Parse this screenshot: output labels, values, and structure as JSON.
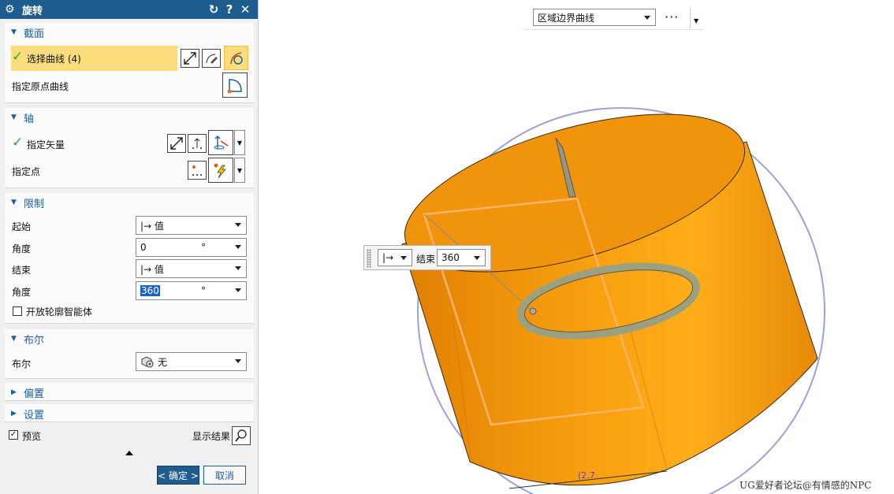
{
  "dialog": {
    "title": "旋转",
    "header_buttons": [
      "reset-icon",
      "help-icon",
      "close-icon"
    ],
    "sections": {
      "section": {
        "title": "截面",
        "select_curve": "选择曲线 (4)",
        "origin_curve": "指定原点曲线"
      },
      "axis": {
        "title": "轴",
        "vector": "指定矢量",
        "point": "指定点"
      },
      "limits": {
        "title": "限制",
        "start_label": "起始",
        "start_value": "|→ 值",
        "start_angle_label": "角度",
        "start_angle": "0",
        "start_unit": "°",
        "end_label": "结束",
        "end_value": "|→ 值",
        "end_angle_label": "角度",
        "end_angle": "360",
        "end_unit": "°",
        "open_profile": "开放轮廓智能体"
      },
      "boolean": {
        "title": "布尔",
        "label": "布尔",
        "value": "无"
      },
      "offset": {
        "title": "偏置"
      },
      "settings": {
        "title": "设置"
      }
    },
    "preview_label": "预览",
    "show_result_label": "显示结果",
    "ok_label": "< 确定 >",
    "cancel_label": "取消"
  },
  "toolbar": {
    "filter_value": "区域边界曲线",
    "more": "···"
  },
  "float_input": {
    "type_symbol": "|→",
    "label": "结束",
    "value": "360"
  },
  "viewport": {
    "dimension_label": "(2.7",
    "watermark": "UG爱好者论坛@有情感的NPC"
  },
  "colors": {
    "title_bar": "#1e5c8e",
    "accent": "#1b5f9e",
    "highlight": "#fcdd7e",
    "body": "#f7a10f",
    "check": "#2ca72c"
  }
}
